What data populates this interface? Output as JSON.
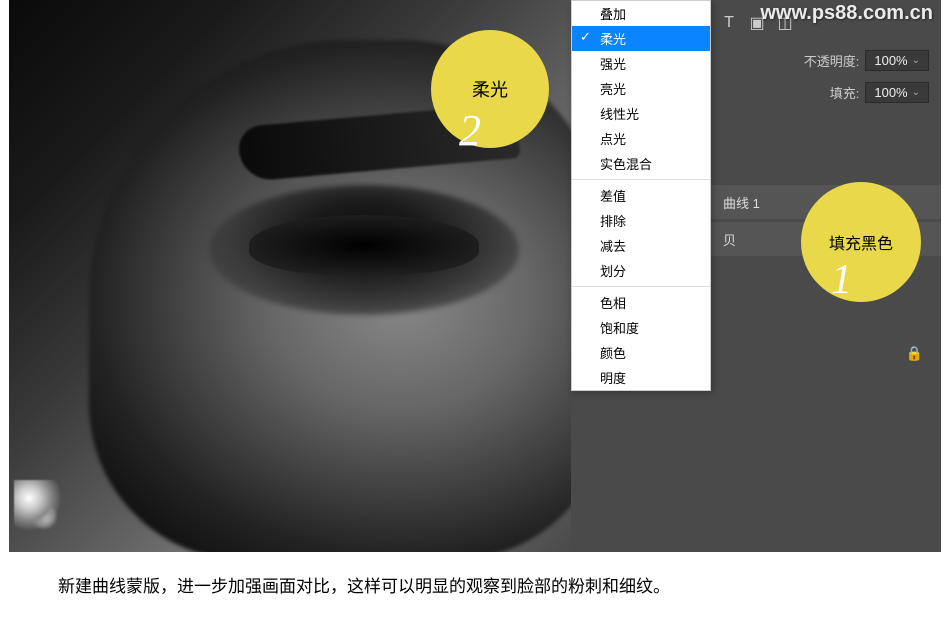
{
  "watermark": "www.ps88.com.cn",
  "toolbar": {
    "opacity_label": "不透明度:",
    "opacity_value": "100%",
    "fill_label": "填充:",
    "fill_value": "100%"
  },
  "layers": {
    "curves": "曲线 1",
    "copy": "贝"
  },
  "blend_modes": {
    "items": [
      "叠加",
      "柔光",
      "强光",
      "亮光",
      "线性光",
      "点光",
      "实色混合"
    ],
    "group2": [
      "差值",
      "排除",
      "减去",
      "划分"
    ],
    "group3": [
      "色相",
      "饱和度",
      "颜色",
      "明度"
    ],
    "selected": "柔光"
  },
  "annotations": {
    "a1": {
      "text": "填充黑色",
      "num": "1"
    },
    "a2": {
      "text": "柔光",
      "num": "2"
    }
  },
  "caption": "新建曲线蒙版，进一步加强画面对比，这样可以明显的观察到脸部的粉刺和细纹。"
}
